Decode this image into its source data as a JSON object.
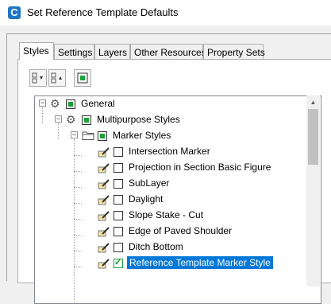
{
  "window": {
    "title": "Set Reference Template Defaults",
    "app_icon": "C"
  },
  "tabs": [
    {
      "label": "Styles",
      "active": true
    },
    {
      "label": "Settings"
    },
    {
      "label": "Layers"
    },
    {
      "label": "Other Resources"
    },
    {
      "label": "Property Sets"
    }
  ],
  "toolbar": {
    "expand_icon": "expand-tree-icon",
    "collapse_icon": "collapse-tree-icon",
    "toggle_icon": "toggle-all-icon"
  },
  "tree": {
    "items": [
      {
        "label": "General",
        "icon": "gear-icon",
        "check": "filled"
      },
      {
        "label": "Multipurpose Styles",
        "icon": "gear-icon",
        "check": "filled"
      },
      {
        "label": "Marker Styles",
        "icon": "folder-icon",
        "check": "filled"
      },
      {
        "label": "Intersection Marker",
        "icon": "style-icon",
        "check": "empty"
      },
      {
        "label": "Projection in Section Basic Figure",
        "icon": "style-icon",
        "check": "empty"
      },
      {
        "label": "SubLayer",
        "icon": "style-icon",
        "check": "empty"
      },
      {
        "label": "Daylight",
        "icon": "style-icon",
        "check": "empty"
      },
      {
        "label": "Slope Stake - Cut",
        "icon": "style-icon",
        "check": "empty"
      },
      {
        "label": "Edge of Paved Shoulder",
        "icon": "style-icon",
        "check": "empty"
      },
      {
        "label": "Ditch Bottom",
        "icon": "style-icon",
        "check": "empty"
      },
      {
        "label": "Reference Template Marker Style",
        "icon": "style-icon",
        "check": "checked",
        "selected": true
      }
    ]
  },
  "colors": {
    "selection": "#0078d7",
    "check_green": "#1aa13b"
  }
}
